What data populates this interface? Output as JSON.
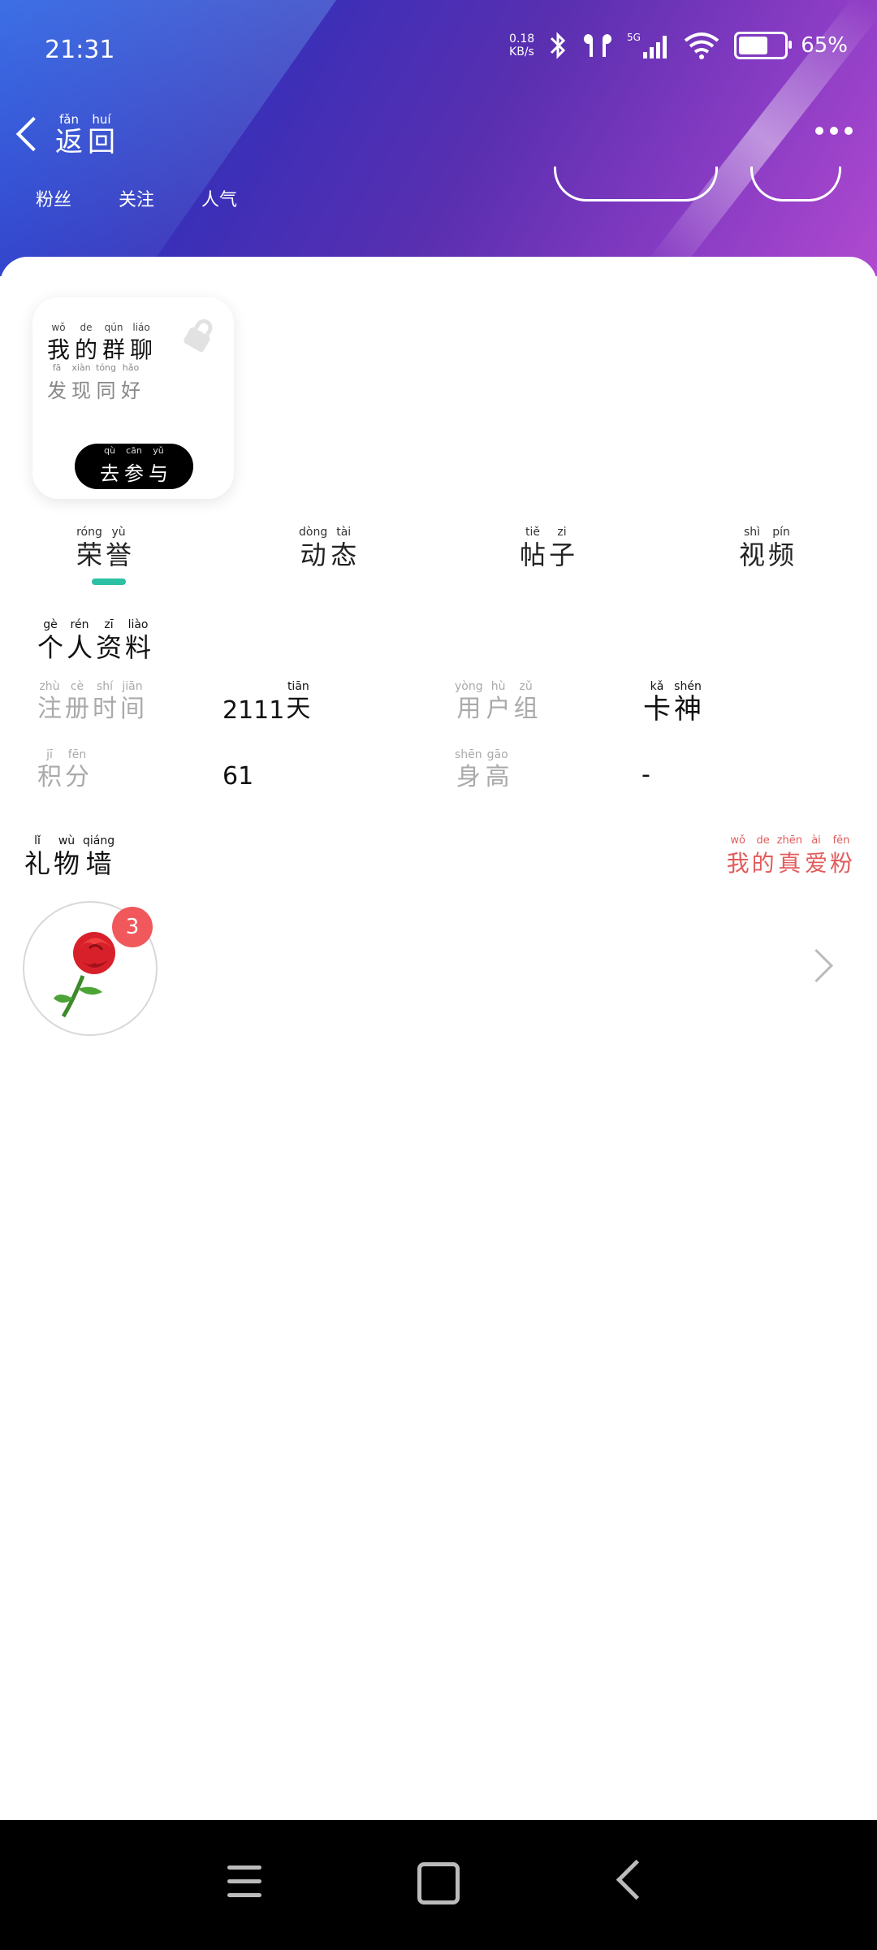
{
  "status": {
    "time": "21:31",
    "speed_top": "0.18",
    "speed_bottom": "KB/s",
    "battery_pct": "65%",
    "battery_level": 0.65
  },
  "nav": {
    "back": [
      {
        "py": "fǎn",
        "hz": "返"
      },
      {
        "py": "huí",
        "hz": "回"
      }
    ]
  },
  "stats": [
    "粉丝",
    "关注",
    "人气"
  ],
  "group_card": {
    "title": [
      {
        "py": "wǒ",
        "hz": "我"
      },
      {
        "py": "de",
        "hz": "的"
      },
      {
        "py": "qún",
        "hz": "群"
      },
      {
        "py": "liáo",
        "hz": "聊"
      }
    ],
    "subtitle": [
      {
        "py": "fā",
        "hz": "发"
      },
      {
        "py": "xiàn",
        "hz": "现"
      },
      {
        "py": "tóng",
        "hz": "同"
      },
      {
        "py": "hǎo",
        "hz": "好"
      }
    ],
    "button": [
      {
        "py": "qù",
        "hz": "去"
      },
      {
        "py": "cān",
        "hz": "参"
      },
      {
        "py": "yǔ",
        "hz": "与"
      }
    ]
  },
  "tabs": [
    [
      {
        "py": "róng",
        "hz": "荣"
      },
      {
        "py": "yù",
        "hz": "誉"
      }
    ],
    [
      {
        "py": "dòng",
        "hz": "动"
      },
      {
        "py": "tài",
        "hz": "态"
      }
    ],
    [
      {
        "py": "tiě",
        "hz": "帖"
      },
      {
        "py": "zi",
        "hz": "子"
      }
    ],
    [
      {
        "py": "shì",
        "hz": "视"
      },
      {
        "py": "pín",
        "hz": "频"
      }
    ]
  ],
  "profile": {
    "title": [
      {
        "py": "gè",
        "hz": "个"
      },
      {
        "py": "rén",
        "hz": "人"
      },
      {
        "py": "zī",
        "hz": "资"
      },
      {
        "py": "liào",
        "hz": "料"
      }
    ],
    "register_label": [
      {
        "py": "zhù",
        "hz": "注"
      },
      {
        "py": "cè",
        "hz": "册"
      },
      {
        "py": "shí",
        "hz": "时"
      },
      {
        "py": "jiān",
        "hz": "间"
      }
    ],
    "register_value_num": "2111",
    "register_value_unit": {
      "py": "tiān",
      "hz": "天"
    },
    "usergroup_label": [
      {
        "py": "yòng",
        "hz": "用"
      },
      {
        "py": "hù",
        "hz": "户"
      },
      {
        "py": "zǔ",
        "hz": "组"
      }
    ],
    "usergroup_value": [
      {
        "py": "kǎ",
        "hz": "卡"
      },
      {
        "py": "shén",
        "hz": "神"
      }
    ],
    "points_label": [
      {
        "py": "jī",
        "hz": "积"
      },
      {
        "py": "fēn",
        "hz": "分"
      }
    ],
    "points_value": "61",
    "height_label": [
      {
        "py": "shēn",
        "hz": "身"
      },
      {
        "py": "gāo",
        "hz": "高"
      }
    ],
    "height_value": "-"
  },
  "gifts": {
    "title": [
      {
        "py": "lǐ",
        "hz": "礼"
      },
      {
        "py": "wù",
        "hz": "物"
      },
      {
        "py": "qiáng",
        "hz": "墙"
      }
    ],
    "fans_link": [
      {
        "py": "wǒ",
        "hz": "我"
      },
      {
        "py": "de",
        "hz": "的"
      },
      {
        "py": "zhēn",
        "hz": "真"
      },
      {
        "py": "ài",
        "hz": "爱"
      },
      {
        "py": "fěn",
        "hz": "粉"
      }
    ],
    "rose_count": "3",
    "rose_icon": "rose-icon"
  }
}
